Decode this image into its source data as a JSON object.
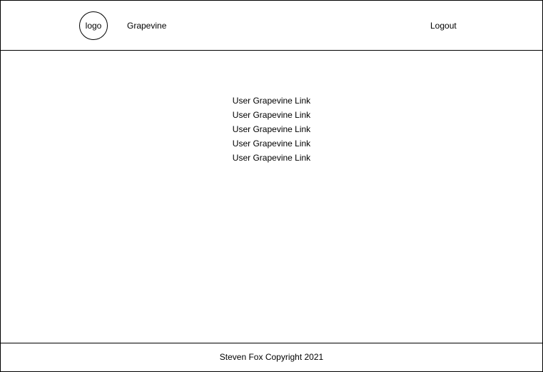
{
  "header": {
    "logo_label": "logo",
    "brand": "Grapevine",
    "logout_label": "Logout"
  },
  "main": {
    "links": [
      {
        "label": "User Grapevine Link"
      },
      {
        "label": "User Grapevine Link"
      },
      {
        "label": "User Grapevine Link"
      },
      {
        "label": "User Grapevine Link"
      },
      {
        "label": "User Grapevine Link"
      }
    ]
  },
  "footer": {
    "copyright": "Steven Fox Copyright 2021"
  }
}
